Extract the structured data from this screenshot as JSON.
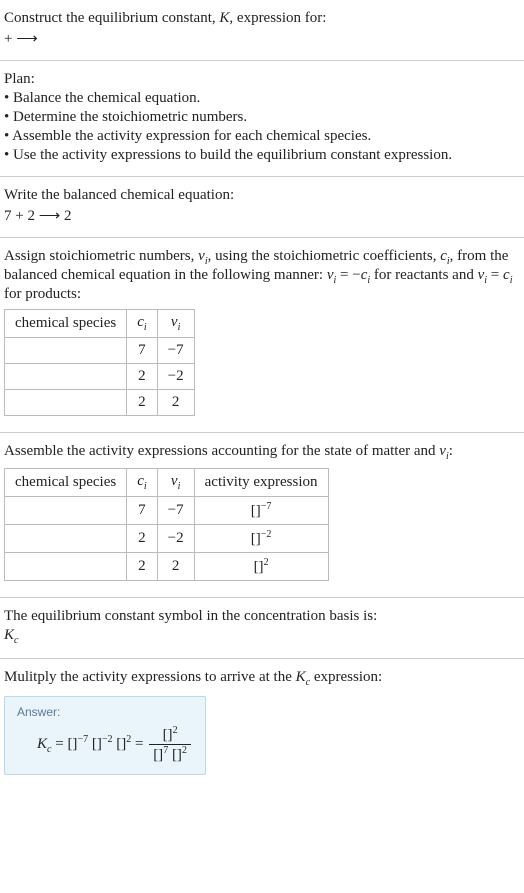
{
  "s1": {
    "l1_a": "Construct the equilibrium constant, ",
    "l1_k": "K",
    "l1_b": ", expression for:",
    "l2": " +  ⟶ "
  },
  "s2": {
    "title": "Plan:",
    "b1": "• Balance the chemical equation.",
    "b2": "• Determine the stoichiometric numbers.",
    "b3": "• Assemble the activity expression for each chemical species.",
    "b4": "• Use the activity expressions to build the equilibrium constant expression."
  },
  "s3": {
    "l1": "Write the balanced chemical equation:",
    "l2": "7  + 2  ⟶ 2 "
  },
  "s4": {
    "pre1": "Assign stoichiometric numbers, ",
    "nu": "ν",
    "i": "i",
    "mid1": ", using the stoichiometric coefficients, ",
    "c": "c",
    "mid2": ", from the balanced chemical equation in the following manner: ",
    "eq1a": " = −",
    "mid3": " for reactants and ",
    "eq2a": " = ",
    "mid4": " for products:",
    "th1": "chemical species",
    "th2_c": "c",
    "th3_nu": "ν",
    "r1c": "7",
    "r1v": "−7",
    "r2c": "2",
    "r2v": "−2",
    "r3c": "2",
    "r3v": "2"
  },
  "s5": {
    "pre": "Assemble the activity expressions accounting for the state of matter and ",
    "nu": "ν",
    "i": "i",
    "colon": ":",
    "th1": "chemical species",
    "th4": "activity expression",
    "r1c": "7",
    "r1v": "−7",
    "r1a_b": "[]",
    "r1a_e": "−7",
    "r2c": "2",
    "r2v": "−2",
    "r2a_b": "[]",
    "r2a_e": "−2",
    "r3c": "2",
    "r3v": "2",
    "r3a_b": "[]",
    "r3a_e": "2"
  },
  "s6": {
    "l1": "The equilibrium constant symbol in the concentration basis is:",
    "k": "K",
    "c": "c"
  },
  "s7": {
    "l1_a": "Mulitply the activity expressions to arrive at the ",
    "k": "K",
    "c": "c",
    "l1_b": " expression:",
    "answer": "Answer:",
    "lhs_k": "K",
    "lhs_c": "c",
    "eq": " = ",
    "t1_b": "[]",
    "t1_e": "−7",
    "t2_b": "[]",
    "t2_e": "−2",
    "t3_b": "[]",
    "t3_e": "2",
    "eq2": " = ",
    "num_b": "[]",
    "num_e": "2",
    "den1_b": "[]",
    "den1_e": "7",
    "den2_b": "[]",
    "den2_e": "2"
  }
}
